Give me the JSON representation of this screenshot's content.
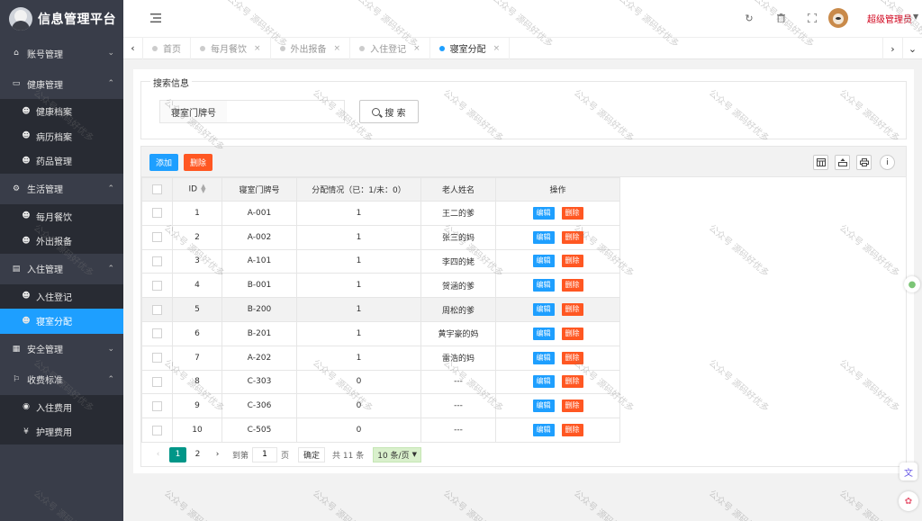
{
  "app": {
    "title": "信息管理平台"
  },
  "sidebar": {
    "groups": [
      {
        "label": "账号管理",
        "icon": "home-icon",
        "expanded": false,
        "items": []
      },
      {
        "label": "健康管理",
        "icon": "card-icon",
        "expanded": true,
        "items": [
          {
            "label": "健康档案",
            "icon": "users-icon"
          },
          {
            "label": "病历档案",
            "icon": "users-icon"
          },
          {
            "label": "药品管理",
            "icon": "users-icon"
          }
        ]
      },
      {
        "label": "生活管理",
        "icon": "gears-icon",
        "expanded": true,
        "items": [
          {
            "label": "每月餐饮",
            "icon": "users-icon"
          },
          {
            "label": "外出报备",
            "icon": "users-icon"
          }
        ]
      },
      {
        "label": "入住管理",
        "icon": "file-icon",
        "expanded": true,
        "items": [
          {
            "label": "入住登记",
            "icon": "users-icon"
          },
          {
            "label": "寝室分配",
            "icon": "users-icon",
            "active": true
          }
        ]
      },
      {
        "label": "安全管理",
        "icon": "calendar-icon",
        "expanded": false,
        "items": []
      },
      {
        "label": "收费标准",
        "icon": "flag-icon",
        "expanded": true,
        "items": [
          {
            "label": "入住费用",
            "icon": "disc-icon"
          },
          {
            "label": "护理费用",
            "icon": "yen-icon"
          }
        ]
      }
    ]
  },
  "header": {
    "user_name": "超级管理员"
  },
  "tabs": [
    {
      "label": "首页",
      "closable": false
    },
    {
      "label": "每月餐饮",
      "closable": true
    },
    {
      "label": "外出报备",
      "closable": true
    },
    {
      "label": "入住登记",
      "closable": true
    },
    {
      "label": "寝室分配",
      "closable": true,
      "active": true
    }
  ],
  "search": {
    "legend": "搜索信息",
    "field_label": "寝室门牌号",
    "value": "",
    "placeholder": "",
    "button_label": "搜 索"
  },
  "toolbar": {
    "add_label": "添加",
    "delete_label": "删除"
  },
  "table": {
    "columns": [
      "ID",
      "寝室门牌号",
      "分配情况（已：1/未：0）",
      "老人姓名",
      "操作"
    ],
    "edit_label": "编辑",
    "delete_label": "删除",
    "rows": [
      {
        "id": "1",
        "room": "A-001",
        "status": "1",
        "name": "王二的爹"
      },
      {
        "id": "2",
        "room": "A-002",
        "status": "1",
        "name": "张三的妈"
      },
      {
        "id": "3",
        "room": "A-101",
        "status": "1",
        "name": "李四的姥"
      },
      {
        "id": "4",
        "room": "B-001",
        "status": "1",
        "name": "贺涵的爹"
      },
      {
        "id": "5",
        "room": "B-200",
        "status": "1",
        "name": "周松的爹"
      },
      {
        "id": "6",
        "room": "B-201",
        "status": "1",
        "name": "黄宇豪的妈"
      },
      {
        "id": "7",
        "room": "A-202",
        "status": "1",
        "name": "雷浩的妈"
      },
      {
        "id": "8",
        "room": "C-303",
        "status": "0",
        "name": "---"
      },
      {
        "id": "9",
        "room": "C-306",
        "status": "0",
        "name": "---"
      },
      {
        "id": "10",
        "room": "C-505",
        "status": "0",
        "name": "---"
      }
    ]
  },
  "pager": {
    "pages": [
      "1",
      "2"
    ],
    "current": "1",
    "goto_prefix": "到第",
    "goto_value": "1",
    "goto_suffix": "页",
    "confirm_label": "确定",
    "total_label": "共 11 条",
    "page_size_label": "10 条/页"
  },
  "watermark": {
    "text": "公众号 源码好优多"
  }
}
